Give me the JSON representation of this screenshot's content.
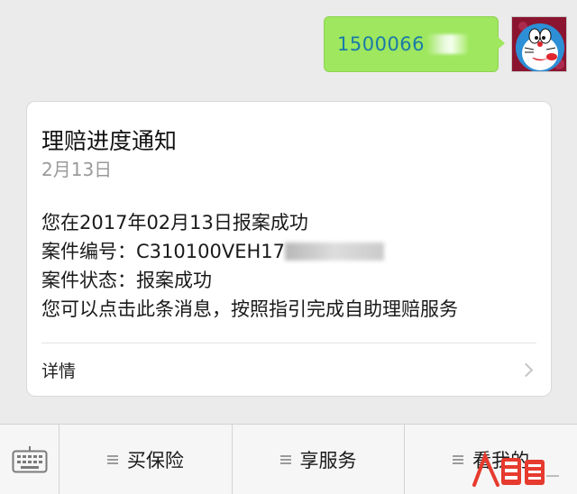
{
  "outgoing_message": {
    "text": "1500066"
  },
  "notification": {
    "title": "理赔进度通知",
    "date": "2月13日",
    "lines": [
      "您在2017年02月13日报案成功",
      "案件编号：C310100VEH17",
      "案件状态：报案成功",
      "您可以点击此条消息，按照指引完成自助理赔服务"
    ],
    "details_label": "详情"
  },
  "menu": {
    "keyboard_icon": "keyboard-icon",
    "items": [
      {
        "label": "买保险"
      },
      {
        "label": "享服务"
      },
      {
        "label": "看我的"
      }
    ]
  },
  "watermark": {
    "logo": "人人都是产品经理 logo"
  },
  "colors": {
    "chat_bg": "#ebebeb",
    "outgoing_bubble": "#9ee75e",
    "outgoing_text": "#1a7aa8",
    "card_bg": "#ffffff",
    "date_text": "#9a9a9a"
  }
}
